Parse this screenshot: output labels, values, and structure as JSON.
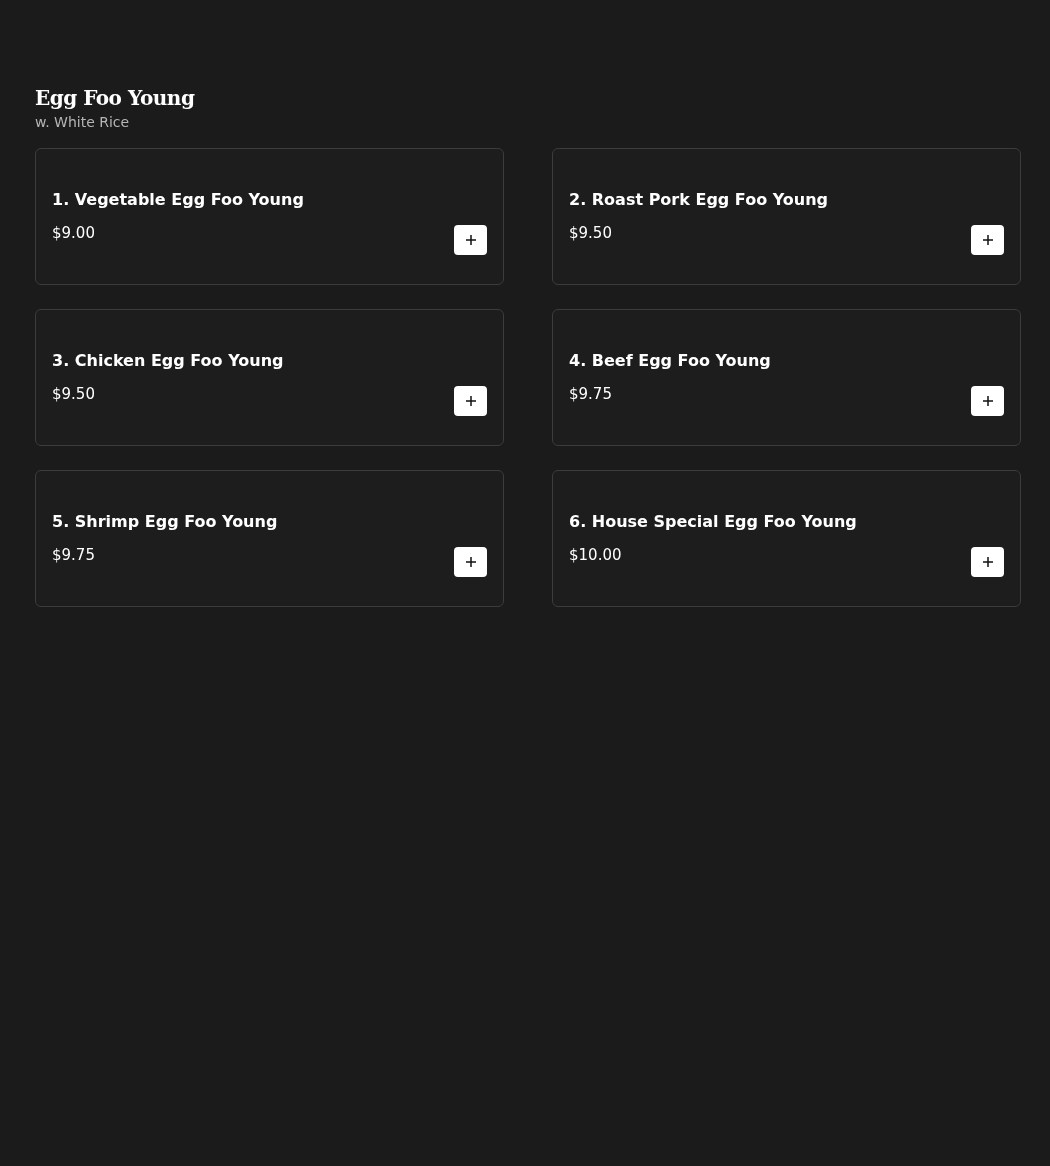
{
  "section": {
    "title": "Egg Foo Young",
    "subtitle": "w. White Rice"
  },
  "items": [
    {
      "name": "1. Vegetable Egg Foo Young",
      "price": "$9.00"
    },
    {
      "name": "2. Roast Pork Egg Foo Young",
      "price": "$9.50"
    },
    {
      "name": "3. Chicken Egg Foo Young",
      "price": "$9.50"
    },
    {
      "name": "4. Beef Egg Foo Young",
      "price": "$9.75"
    },
    {
      "name": "5. Shrimp Egg Foo Young",
      "price": "$9.75"
    },
    {
      "name": "6. House Special Egg Foo Young",
      "price": "$10.00"
    }
  ]
}
